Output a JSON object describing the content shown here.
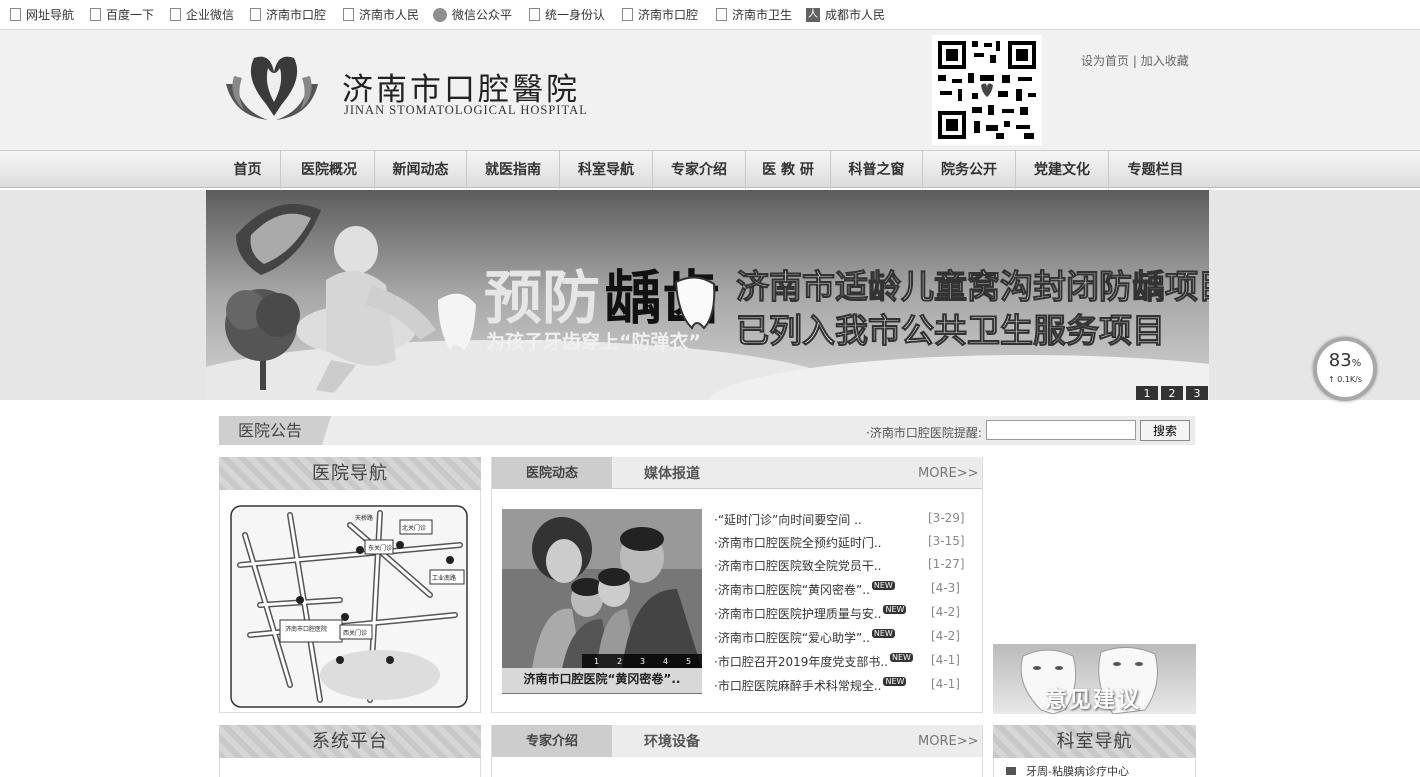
{
  "bookmarks": [
    "网址导航",
    "百度一下",
    "企业微信",
    "济南市口腔",
    "济南市人民",
    "微信公众平",
    "统一身份认",
    "济南市口腔",
    "济南市卫生",
    "成都市人民"
  ],
  "header": {
    "logo_cn": "济南市口腔醫院",
    "logo_en": "JINAN STOMATOLOGICAL HOSPITAL",
    "set_home": "设为首页",
    "separator": "|",
    "add_fav": "加入收藏"
  },
  "nav": [
    "首页",
    "医院概况",
    "新闻动态",
    "就医指南",
    "科室导航",
    "专家介绍",
    "医 教 研",
    "科普之窗",
    "院务公开",
    "党建文化",
    "专题栏目"
  ],
  "banner": {
    "title_a": "预防",
    "title_b": "龋齿",
    "subtitle": "为孩子牙齿穿上“防弹衣”",
    "line1": "济南市适龄儿童窝沟封闭防龋项目",
    "line2": "已列入我市公共卫生服务项目",
    "pages": [
      "1",
      "2",
      "3"
    ]
  },
  "notice": {
    "tab": "医院公告",
    "text": "·济南市口腔医院提醒:",
    "search_label": "搜索"
  },
  "hospital_nav": {
    "title": "医院导航"
  },
  "news": {
    "tab_active": "医院动态",
    "tab_other": "媒体报道",
    "more": "MORE>>",
    "caption": "济南市口腔医院“黄冈密卷”..",
    "pages": [
      "1",
      "2",
      "3",
      "4",
      "5"
    ],
    "items": [
      {
        "title": "·“延时门诊”向时间要空间 ..",
        "date": "[3-29]",
        "new": false
      },
      {
        "title": "·济南市口腔医院全预约延时门..",
        "date": "[3-15]",
        "new": false
      },
      {
        "title": "·济南市口腔医院致全院党员干..",
        "date": "[1-27]",
        "new": false
      },
      {
        "title": "·济南市口腔医院“黄冈密卷”..",
        "date": "[4-3]",
        "new": true
      },
      {
        "title": "·济南市口腔医院护理质量与安..",
        "date": "[4-2]",
        "new": true
      },
      {
        "title": "·济南市口腔医院“爱心助学”..",
        "date": "[4-2]",
        "new": true
      },
      {
        "title": "·市口腔召开2019年度党支部书..",
        "date": "[4-1]",
        "new": true
      },
      {
        "title": "·市口腔医院麻醉手术科常规全..",
        "date": "[4-1]",
        "new": true
      }
    ],
    "new_badge": "NEW"
  },
  "opinion": "意见建议",
  "system": {
    "title": "系统平台"
  },
  "expert": {
    "tab_active": "专家介绍",
    "tab_other": "环境设备",
    "more": "MORE>>"
  },
  "dept": {
    "title": "科室导航",
    "first": "牙周-粘膜病诊疗中心"
  },
  "float_widget": {
    "percent": "83",
    "unit": "%",
    "speed": "↑ 0.1K/s"
  },
  "map_labels": {
    "center": "济南市口腔医院",
    "east": "东关门诊",
    "tiangiao": "天桥路",
    "west": "西关门诊",
    "industry": "工业南路",
    "north": "北关门诊"
  }
}
